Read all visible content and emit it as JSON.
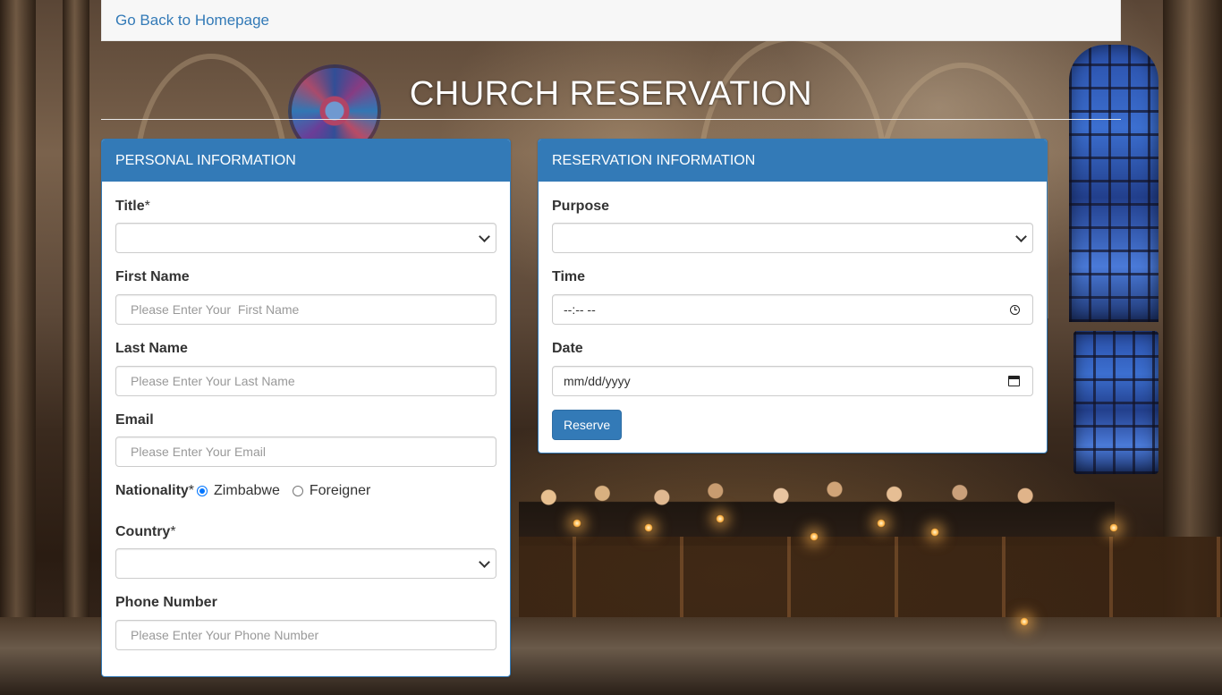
{
  "nav": {
    "back_link": "Go Back to Homepage"
  },
  "page_title": "CHURCH RESERVATION",
  "personal": {
    "heading": "PERSONAL INFORMATION",
    "title_label": "Title",
    "title_value": "",
    "first_name_label": "First Name",
    "first_name_placeholder": "Please Enter Your  First Name",
    "last_name_label": "Last Name",
    "last_name_placeholder": "Please Enter Your Last Name",
    "email_label": "Email",
    "email_placeholder": "Please Enter Your Email",
    "nationality_label": "Nationality",
    "nationality_options": [
      "Zimbabwe",
      "Foreigner"
    ],
    "nationality_selected": "Zimbabwe",
    "country_label": "Country",
    "country_value": "",
    "phone_label": "Phone Number",
    "phone_placeholder": "Please Enter Your Phone Number",
    "required_mark": "*"
  },
  "reservation": {
    "heading": "RESERVATION INFORMATION",
    "purpose_label": "Purpose",
    "purpose_value": "",
    "time_label": "Time",
    "time_value": "--:-- --",
    "date_label": "Date",
    "date_value": "mm/dd/yyyy",
    "reserve_button": "Reserve"
  },
  "colors": {
    "primary": "#337ab7",
    "link": "#337ab7",
    "radio_checked": "#0075ff"
  },
  "icons": {
    "select": "chevron-down-icon",
    "time": "clock-icon",
    "date": "calendar-icon"
  }
}
